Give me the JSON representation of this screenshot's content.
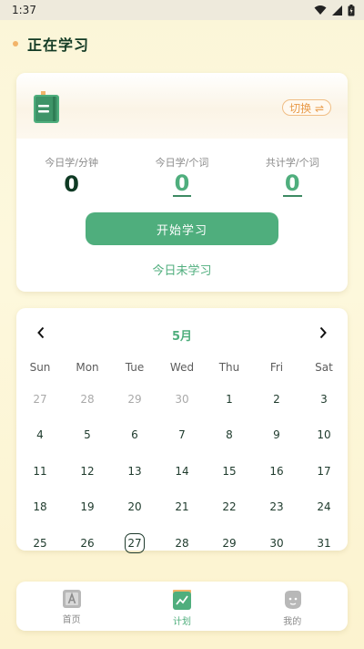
{
  "status_bar": {
    "time": "1:37"
  },
  "header": {
    "title": "正在学习"
  },
  "study": {
    "switch_label": "切换 ⇌",
    "stats": [
      {
        "label": "今日学/分钟",
        "value": "0"
      },
      {
        "label": "今日学/个词",
        "value": "0"
      },
      {
        "label": "共计学/个词",
        "value": "0"
      }
    ],
    "start_button": "开始学习",
    "status_text": "今日未学习"
  },
  "calendar": {
    "month": "5月",
    "weekdays": [
      "Sun",
      "Mon",
      "Tue",
      "Wed",
      "Thu",
      "Fri",
      "Sat"
    ],
    "weeks": [
      [
        "27",
        "28",
        "29",
        "30",
        "1",
        "2",
        "3"
      ],
      [
        "4",
        "5",
        "6",
        "7",
        "8",
        "9",
        "10"
      ],
      [
        "11",
        "12",
        "13",
        "14",
        "15",
        "16",
        "17"
      ],
      [
        "18",
        "19",
        "20",
        "21",
        "22",
        "23",
        "24"
      ],
      [
        "25",
        "26",
        "27",
        "28",
        "29",
        "30",
        "31"
      ]
    ],
    "muted_days_first_row": 4,
    "today": "27"
  },
  "tabbar": {
    "tabs": [
      {
        "label": "首页",
        "icon": "vocabulary-icon"
      },
      {
        "label": "计划",
        "icon": "plan-chart-icon",
        "active": true
      },
      {
        "label": "我的",
        "icon": "profile-face-icon"
      }
    ]
  },
  "colors": {
    "accent": "#4fae7d",
    "orange": "#e89a48",
    "text": "#1e3a2c"
  }
}
